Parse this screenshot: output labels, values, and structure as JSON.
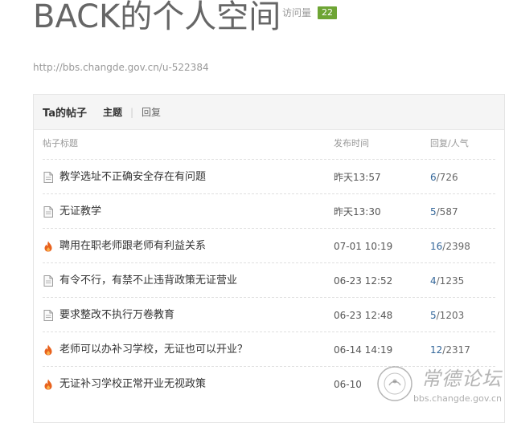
{
  "page": {
    "title": "BACK的个人空间",
    "visits_label": "访问量",
    "visits_count": "22",
    "url": "http://bbs.changde.gov.cn/u-522384"
  },
  "panel": {
    "title": "Ta的帖子",
    "tab_topics": "主题",
    "tab_separator": "|",
    "tab_replies": "回复",
    "columns": {
      "subject": "帖子标题",
      "time": "发布时间",
      "stats": "回复/人气"
    },
    "rows": [
      {
        "icon": "document-icon",
        "subject": "教学选址不正确安全存在有问题",
        "time": "昨天13:57",
        "replies": "6",
        "views": "/726"
      },
      {
        "icon": "document-icon",
        "subject": "无证教学",
        "time": "昨天13:30",
        "replies": "5",
        "views": "/587"
      },
      {
        "icon": "hot-flame-icon",
        "subject": "聘用在职老师跟老师有利益关系",
        "time": "07-01 10:19",
        "replies": "16",
        "views": "/2398"
      },
      {
        "icon": "document-icon",
        "subject": "有令不行，有禁不止违背政策无证营业",
        "time": "06-23 12:52",
        "replies": "4",
        "views": "/1235"
      },
      {
        "icon": "document-icon",
        "subject": "要求整改不执行万卷教育",
        "time": "06-23 12:48",
        "replies": "5",
        "views": "/1203"
      },
      {
        "icon": "hot-flame-icon",
        "subject": "老师可以办补习学校，无证也可以开业？",
        "time": "06-14 14:19",
        "replies": "12",
        "views": "/2317"
      },
      {
        "icon": "hot-flame-icon",
        "subject": "无证补习学校正常开业无视政策",
        "time": "06-10",
        "replies": "",
        "views": ""
      }
    ]
  },
  "watermark": {
    "name": "常德论坛",
    "url": "bbs.changde.gov.cn",
    "seal_text": "常德论坛 bbs.changde.gov.cn"
  },
  "colors": {
    "visits_badge": "#6ea534",
    "reply_link": "#336699",
    "flame": "#e8621d"
  }
}
